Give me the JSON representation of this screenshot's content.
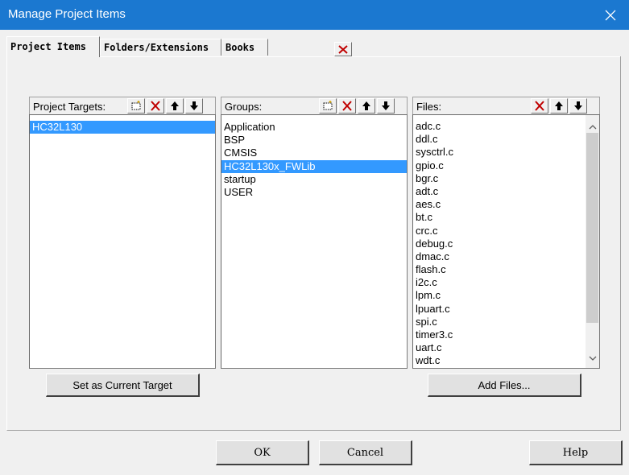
{
  "window": {
    "title": "Manage Project Items"
  },
  "tabs": [
    {
      "label": "Project Items",
      "active": true
    },
    {
      "label": "Folders/Extensions",
      "active": false
    },
    {
      "label": "Books",
      "active": false
    }
  ],
  "targets": {
    "label": "Project Targets:",
    "items": [
      "HC32L130"
    ],
    "selected_index": 0
  },
  "groups": {
    "label": "Groups:",
    "items": [
      "Application",
      "BSP",
      "CMSIS",
      "HC32L130x_FWLib",
      "startup",
      "USER"
    ],
    "selected_index": 3
  },
  "files": {
    "label": "Files:",
    "items": [
      "adc.c",
      "ddl.c",
      "sysctrl.c",
      "gpio.c",
      "bgr.c",
      "adt.c",
      "aes.c",
      "bt.c",
      "crc.c",
      "debug.c",
      "dmac.c",
      "flash.c",
      "i2c.c",
      "lpm.c",
      "lpuart.c",
      "spi.c",
      "timer3.c",
      "uart.c",
      "wdt.c"
    ]
  },
  "buttons": {
    "set_target": "Set as Current Target",
    "add_files": "Add Files...",
    "ok": "OK",
    "cancel": "Cancel",
    "help": "Help"
  },
  "icons": {
    "new": "new-item-icon",
    "delete": "delete-x-icon",
    "up": "move-up-arrow-icon",
    "down": "move-down-arrow-icon",
    "close": "window-close-icon"
  },
  "colors": {
    "titlebar": "#1b78d0",
    "selection": "#3399ff",
    "delete_red": "#c00000"
  }
}
